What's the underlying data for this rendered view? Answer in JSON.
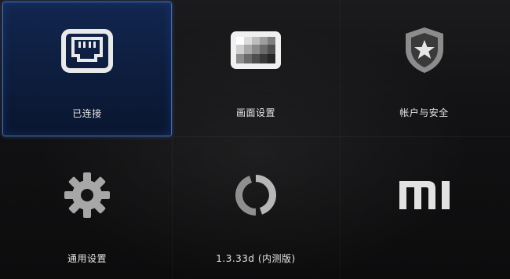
{
  "menu": {
    "items": [
      {
        "label": "已连接",
        "icon": "ethernet-icon",
        "selected": true
      },
      {
        "label": "画面设置",
        "icon": "picture-settings-icon",
        "selected": false
      },
      {
        "label": "帐户与安全",
        "icon": "shield-star-icon",
        "selected": false
      },
      {
        "label": "通用设置",
        "icon": "gear-icon",
        "selected": false
      },
      {
        "label": "1.3.33d (内测版)",
        "icon": "update-sync-icon",
        "selected": false
      },
      {
        "label": "MI",
        "icon": "mi-logo-icon",
        "selected": false
      }
    ]
  },
  "colors": {
    "selection_border": "#3f6fb6",
    "selection_fill": "#12264f",
    "icon_light": "#e9e9e9",
    "icon_grey": "#9a9a9a"
  }
}
